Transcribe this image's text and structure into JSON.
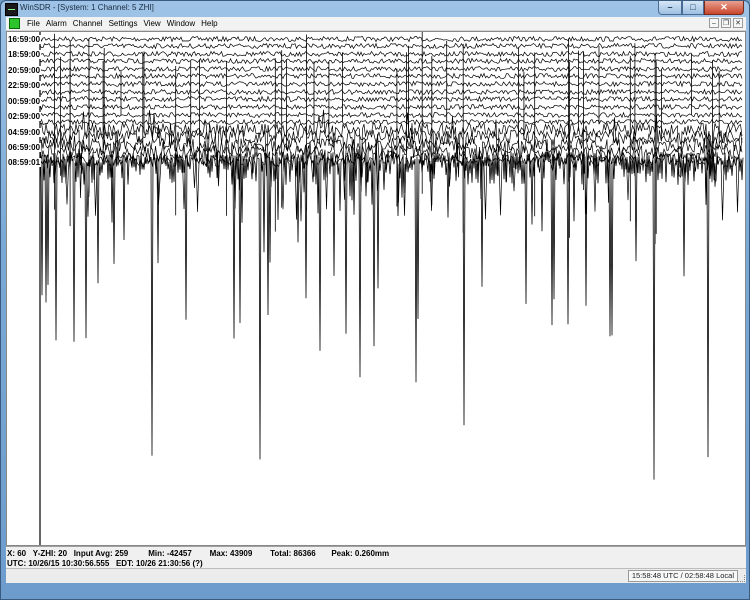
{
  "window": {
    "title": "WinSDR - [System: 1  Channel: 5 ZHI]"
  },
  "menu": {
    "items": [
      "File",
      "Alarm",
      "Channel",
      "Settings",
      "View",
      "Window",
      "Help"
    ]
  },
  "plot": {
    "time_labels": [
      "16:59:00",
      "18:59:00",
      "20:59:00",
      "22:59:00",
      "00:59:00",
      "02:59:00",
      "04:59:00",
      "06:59:00",
      "08:59:01"
    ]
  },
  "status": {
    "x": "X: 60",
    "y": "Y-ZHI: 20",
    "input_avg": "Input Avg: 259",
    "min": "Min: -42457",
    "max": "Max: 43909",
    "total": "Total: 86366",
    "peak": "Peak: 0.260mm",
    "utc": "UTC: 10/26/15 10:30:56.555",
    "edt": "EDT: 10/26 21:30:56 (?)"
  },
  "clock": "15:58:48 UTC / 02:58:48 Local",
  "colors": {
    "titlebar": "#7aa9d6",
    "trace": "#000000",
    "plot_bg": "#ffffff",
    "close_button": "#c8452c",
    "mdi_icon": "#2cc52c"
  }
}
